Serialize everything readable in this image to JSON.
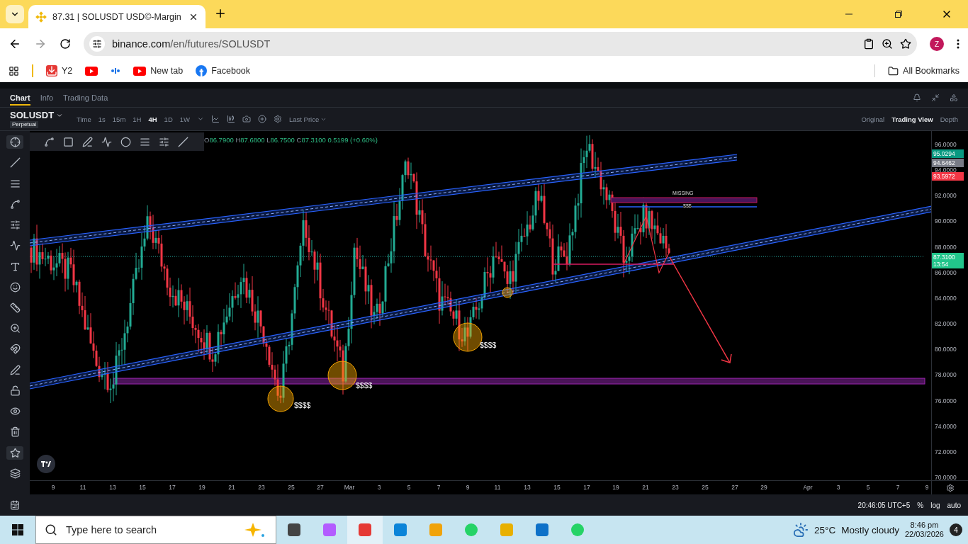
{
  "browser": {
    "tab": {
      "title": "87.31 | SOLUSDT USD©-Margin"
    },
    "address": {
      "host": "binance.com",
      "path": "/en/futures/SOLUSDT"
    },
    "bookmarks": [
      {
        "kind": "download",
        "label": "Y2"
      },
      {
        "kind": "youtube"
      },
      {
        "kind": "dots"
      },
      {
        "kind": "youtube",
        "label": "New tab"
      },
      {
        "kind": "facebook",
        "label": "Facebook"
      }
    ],
    "all_bookmarks": "All Bookmarks",
    "profile": "Z"
  },
  "page_tabs": [
    {
      "label": "Chart",
      "selected": true
    },
    {
      "label": "Info",
      "selected": false
    },
    {
      "label": "Trading Data",
      "selected": false
    }
  ],
  "symbol": {
    "name": "SOLUSDT",
    "badge": "Perpetual"
  },
  "time_label": "Time",
  "intervals": [
    {
      "label": "1s",
      "selected": false
    },
    {
      "label": "15m",
      "selected": false
    },
    {
      "label": "1H",
      "selected": false
    },
    {
      "label": "4H",
      "selected": true
    },
    {
      "label": "1D",
      "selected": false
    },
    {
      "label": "1W",
      "selected": false
    }
  ],
  "price_source": "Last Price",
  "views": [
    {
      "label": "Original",
      "selected": false
    },
    {
      "label": "Trading View",
      "selected": true
    },
    {
      "label": "Depth",
      "selected": false
    }
  ],
  "ohlc": [
    {
      "label": "O",
      "value": "86.7900"
    },
    {
      "label": "H",
      "value": "87.6800"
    },
    {
      "label": "L",
      "value": "86.7500"
    },
    {
      "label": "C",
      "value": "87.3100"
    }
  ],
  "change": "0.5199 (+0.60%)",
  "price_ticks": [
    "96.0000",
    "94.0000",
    "92.0000",
    "90.0000",
    "88.0000",
    "86.0000",
    "84.0000",
    "82.0000",
    "80.0000",
    "78.0000",
    "76.0000",
    "74.0000",
    "72.0000",
    "70.0000"
  ],
  "price_tags": [
    {
      "value": "95.0294",
      "color": "#089981"
    },
    {
      "value": "94.6462",
      "color": "#787b86"
    },
    {
      "value": "93.5972",
      "color": "#f23645"
    },
    {
      "value": "87.3100",
      "sub": "13:54",
      "color": "#22c58b"
    }
  ],
  "time_labels": [
    "9",
    "11",
    "13",
    "15",
    "17",
    "19",
    "21",
    "23",
    "25",
    "27",
    "Mar",
    "3",
    "5",
    "7",
    "9",
    "11",
    "13",
    "15",
    "17",
    "19",
    "21",
    "23",
    "25",
    "27",
    "29",
    "Apr",
    "3",
    "5",
    "7",
    "9"
  ],
  "annotations": {
    "zone_label": "MISSING",
    "line_label": "$$$",
    "liquidity": [
      "$$$$",
      "$$$$",
      "$$$$"
    ]
  },
  "status": {
    "clock": "20:46:05 UTC+5",
    "options": [
      "%",
      "log",
      "auto"
    ]
  },
  "taskbar": {
    "search_placeholder": "Type here to search",
    "temperature": "25°C",
    "weather": "Mostly cloudy",
    "time": "8:46 pm",
    "date": "22/03/2026",
    "notifications": "4"
  }
}
